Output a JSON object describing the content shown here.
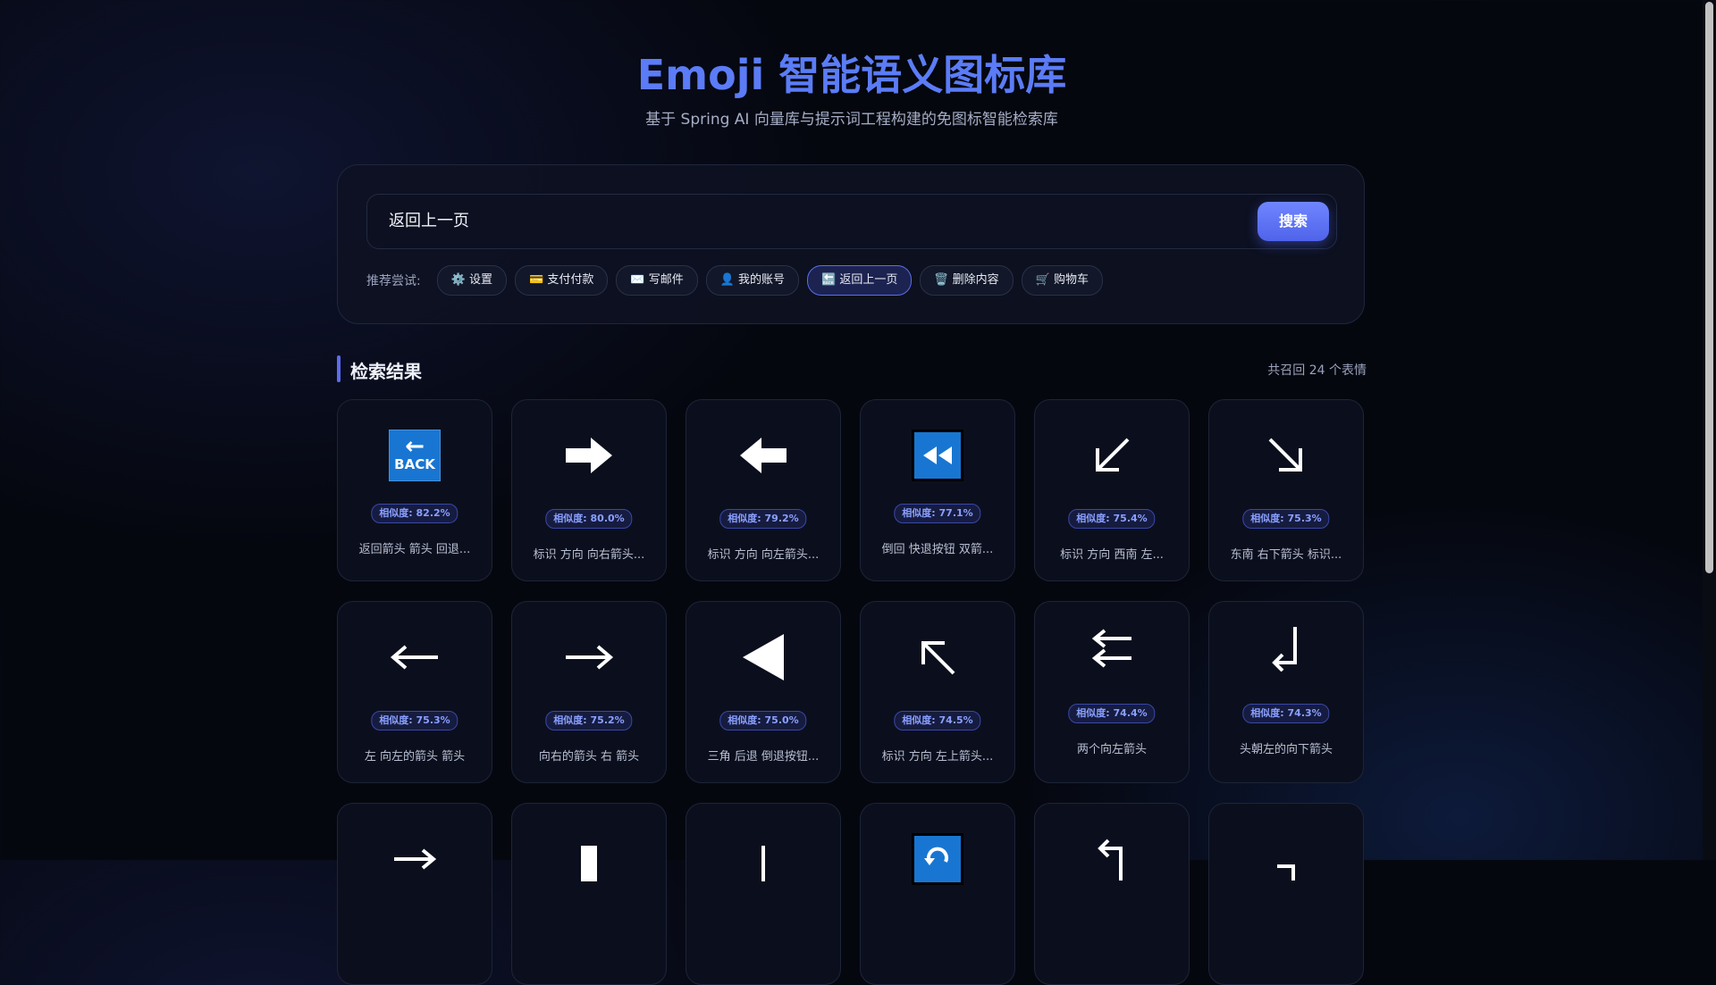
{
  "header": {
    "title": "Emoji 智能语义图标库",
    "subtitle": "基于 Spring AI 向量库与提示词工程构建的免图标智能检索库"
  },
  "search": {
    "value": "返回上一页",
    "button_label": "搜索"
  },
  "suggestions": {
    "label": "推荐尝试:",
    "chips": [
      {
        "label": "⚙️ 设置"
      },
      {
        "label": "💳 支付付款"
      },
      {
        "label": "✉️ 写邮件"
      },
      {
        "label": "👤 我的账号"
      },
      {
        "label": "🔙 返回上一页"
      },
      {
        "label": "🗑️ 删除内容"
      },
      {
        "label": "🛒 购物车"
      }
    ]
  },
  "results": {
    "title": "检索结果",
    "count_text": "共召回 24 个表情",
    "items": [
      {
        "icon": "back-arrow-icon",
        "similarity": "相似度: 82.2%",
        "desc": "返回箭头 箭头 回退..."
      },
      {
        "icon": "right-arrow-icon",
        "similarity": "相似度: 80.0%",
        "desc": "标识 方向 向右箭头..."
      },
      {
        "icon": "left-arrow-icon",
        "similarity": "相似度: 79.2%",
        "desc": "标识 方向 向左箭头..."
      },
      {
        "icon": "fast-reverse-icon",
        "similarity": "相似度: 77.1%",
        "desc": "倒回 快退按钮 双箭..."
      },
      {
        "icon": "down-left-arrow-icon",
        "similarity": "相似度: 75.4%",
        "desc": "标识 方向 西南 左..."
      },
      {
        "icon": "down-right-arrow-icon",
        "similarity": "相似度: 75.3%",
        "desc": "东南 右下箭头 标识..."
      },
      {
        "icon": "leftwards-arrow-icon",
        "similarity": "相似度: 75.3%",
        "desc": "左 向左的箭头 箭头"
      },
      {
        "icon": "rightwards-arrow-icon",
        "similarity": "相似度: 75.2%",
        "desc": "向右的箭头 右 箭头"
      },
      {
        "icon": "reverse-triangle-icon",
        "similarity": "相似度: 75.0%",
        "desc": "三角 后退 倒退按钮..."
      },
      {
        "icon": "up-left-arrow-icon",
        "similarity": "相似度: 74.5%",
        "desc": "标识 方向 左上箭头..."
      },
      {
        "icon": "two-left-arrows-icon",
        "similarity": "相似度: 74.4%",
        "desc": "两个向左箭头"
      },
      {
        "icon": "down-left-hook-arrow-icon",
        "similarity": "相似度: 74.3%",
        "desc": "头朝左的向下箭头"
      }
    ]
  },
  "colors": {
    "accent": "#5b7cf6",
    "button": "#5b6cf0",
    "background": "#05070f"
  }
}
